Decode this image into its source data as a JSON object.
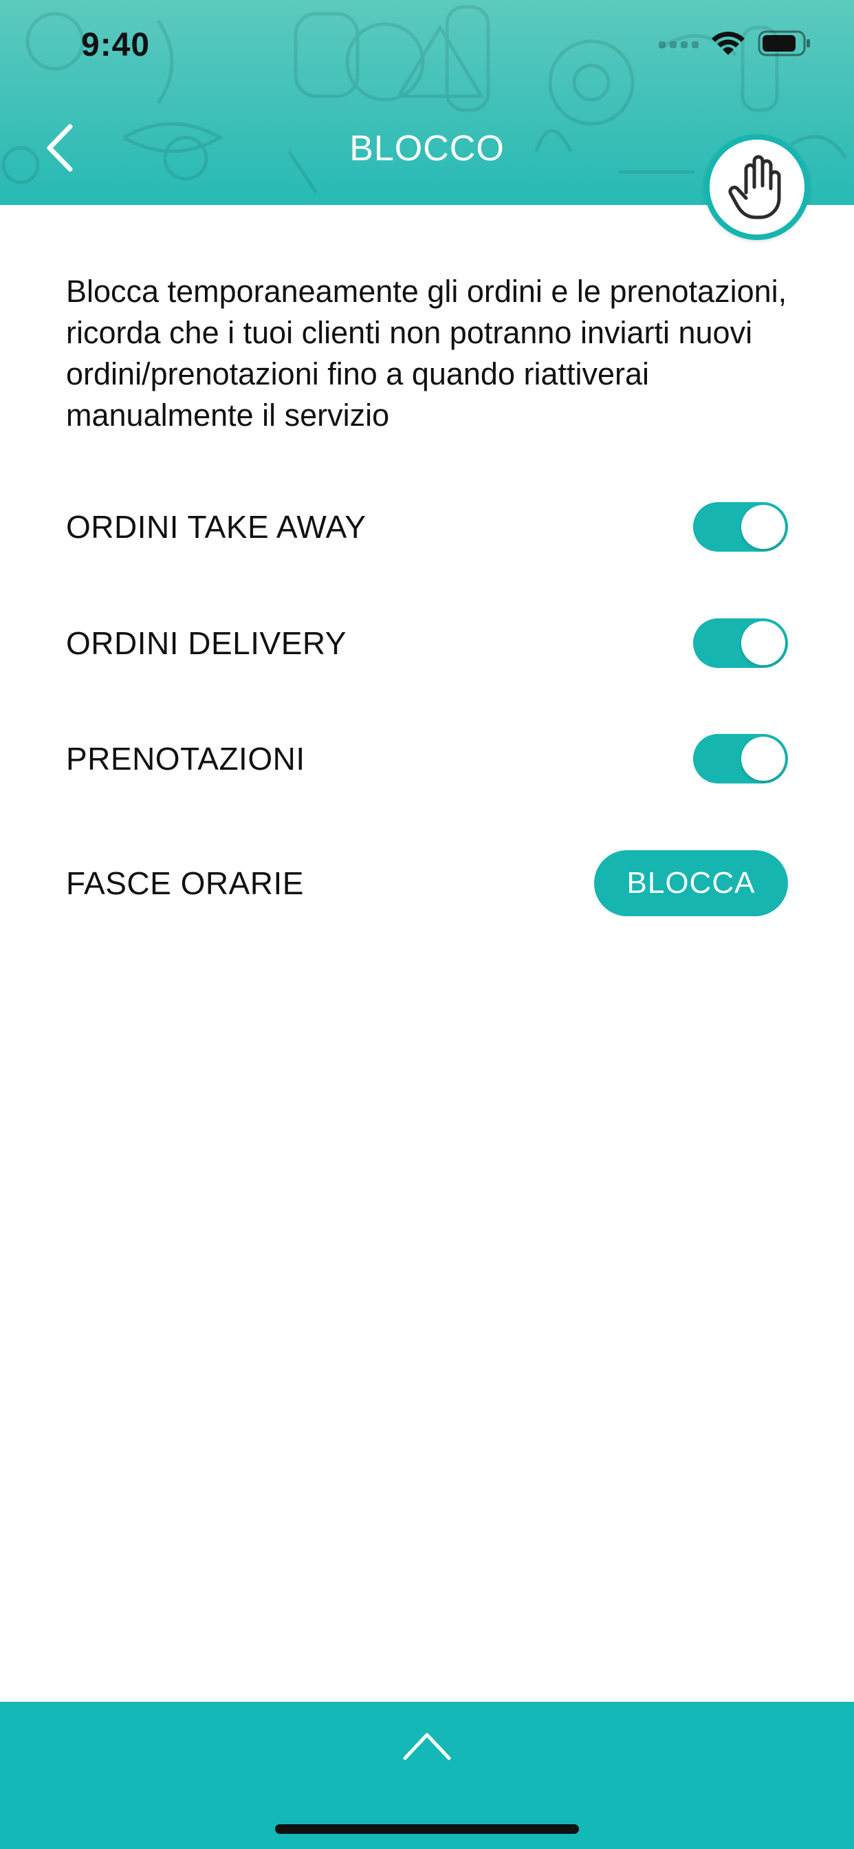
{
  "status_bar": {
    "time": "9:40",
    "icons": [
      "cellular-signal-icon",
      "wifi-icon",
      "battery-icon"
    ]
  },
  "header": {
    "title": "BLOCCO",
    "back_icon": "chevron-left-icon",
    "badge_icon": "hand-stop-icon"
  },
  "description": "Blocca temporaneamente gli ordini e le prenotazioni, ricorda che i tuoi clienti non potranno inviarti nuovi ordini/prenotazioni fino a quando riattiverai manualmente il servizio",
  "settings": [
    {
      "label": "ORDINI TAKE AWAY",
      "enabled": true
    },
    {
      "label": "ORDINI DELIVERY",
      "enabled": true
    },
    {
      "label": "PRENOTAZIONI",
      "enabled": true
    }
  ],
  "time_slots": {
    "label": "FASCE ORARIE",
    "button_label": "BLOCCA"
  },
  "bottom_bar": {
    "icon": "chevron-up-icon"
  },
  "colors": {
    "accent": "#16b5b0",
    "header_top": "#5dcabf",
    "bottom_bar": "#14b8b6",
    "text": "#111111"
  }
}
